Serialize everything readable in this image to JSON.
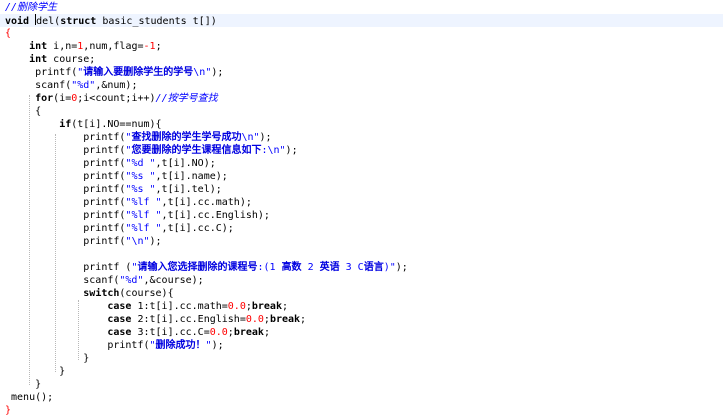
{
  "editor": {
    "lines": [
      [
        {
          "t": "cmt",
          "v": "//删除学生"
        }
      ],
      [
        {
          "t": "kw",
          "v": "void "
        },
        {
          "t": "plain",
          "v": "del"
        },
        {
          "t": "plain",
          "v": "("
        },
        {
          "t": "kw",
          "v": "struct"
        },
        {
          "t": "plain",
          "v": " basic_students t[])"
        }
      ],
      [
        {
          "t": "brace-red",
          "v": "{"
        }
      ],
      [
        {
          "t": "plain",
          "v": "    "
        },
        {
          "t": "kw",
          "v": "int"
        },
        {
          "t": "plain",
          "v": " i,n="
        },
        {
          "t": "num",
          "v": "1"
        },
        {
          "t": "plain",
          "v": ",num,flag="
        },
        {
          "t": "num",
          "v": "-1"
        },
        {
          "t": "plain",
          "v": ";"
        }
      ],
      [
        {
          "t": "plain",
          "v": "    "
        },
        {
          "t": "kw",
          "v": "int"
        },
        {
          "t": "plain",
          "v": " course;"
        }
      ],
      [
        {
          "t": "plain",
          "v": "     printf("
        },
        {
          "t": "str",
          "v": "\""
        },
        {
          "t": "cjk",
          "v": "请输入要删除学生的学号"
        },
        {
          "t": "str",
          "v": "\\n\""
        },
        {
          "t": "plain",
          "v": ");"
        }
      ],
      [
        {
          "t": "plain",
          "v": "     scanf("
        },
        {
          "t": "str",
          "v": "\"%d\""
        },
        {
          "t": "plain",
          "v": ",&num);"
        }
      ],
      [
        {
          "t": "plain",
          "v": "     "
        },
        {
          "t": "kw",
          "v": "for"
        },
        {
          "t": "plain",
          "v": "(i="
        },
        {
          "t": "num",
          "v": "0"
        },
        {
          "t": "plain",
          "v": ";i<count;i++)"
        },
        {
          "t": "cmt",
          "v": "//按学号查找"
        }
      ],
      [
        {
          "t": "plain",
          "v": "     {"
        }
      ],
      [
        {
          "t": "plain",
          "v": "         "
        },
        {
          "t": "kw",
          "v": "if"
        },
        {
          "t": "plain",
          "v": "(t[i].NO==num){"
        }
      ],
      [
        {
          "t": "plain",
          "v": "             printf("
        },
        {
          "t": "str",
          "v": "\""
        },
        {
          "t": "cjk",
          "v": "查找删除的学生学号成功"
        },
        {
          "t": "str",
          "v": "\\n\""
        },
        {
          "t": "plain",
          "v": ");"
        }
      ],
      [
        {
          "t": "plain",
          "v": "             printf("
        },
        {
          "t": "str",
          "v": "\""
        },
        {
          "t": "cjk",
          "v": "您要删除的学生课程信息如下"
        },
        {
          "t": "str",
          "v": ":\\n\""
        },
        {
          "t": "plain",
          "v": ");"
        }
      ],
      [
        {
          "t": "plain",
          "v": "             printf("
        },
        {
          "t": "str",
          "v": "\"%d \""
        },
        {
          "t": "plain",
          "v": ",t[i].NO);"
        }
      ],
      [
        {
          "t": "plain",
          "v": "             printf("
        },
        {
          "t": "str",
          "v": "\"%s \""
        },
        {
          "t": "plain",
          "v": ",t[i].name);"
        }
      ],
      [
        {
          "t": "plain",
          "v": "             printf("
        },
        {
          "t": "str",
          "v": "\"%s \""
        },
        {
          "t": "plain",
          "v": ",t[i].tel);"
        }
      ],
      [
        {
          "t": "plain",
          "v": "             printf("
        },
        {
          "t": "str",
          "v": "\"%lf \""
        },
        {
          "t": "plain",
          "v": ",t[i].cc.math);"
        }
      ],
      [
        {
          "t": "plain",
          "v": "             printf("
        },
        {
          "t": "str",
          "v": "\"%lf \""
        },
        {
          "t": "plain",
          "v": ",t[i].cc.English);"
        }
      ],
      [
        {
          "t": "plain",
          "v": "             printf("
        },
        {
          "t": "str",
          "v": "\"%lf \""
        },
        {
          "t": "plain",
          "v": ",t[i].cc.C);"
        }
      ],
      [
        {
          "t": "plain",
          "v": "             printf("
        },
        {
          "t": "str",
          "v": "\"\\n\""
        },
        {
          "t": "plain",
          "v": ");"
        }
      ],
      [
        {
          "t": "plain",
          "v": ""
        }
      ],
      [
        {
          "t": "plain",
          "v": "             printf ("
        },
        {
          "t": "str",
          "v": "\""
        },
        {
          "t": "cjk",
          "v": "请输入您选择删除的课程号"
        },
        {
          "t": "str",
          "v": ":(1 "
        },
        {
          "t": "cjk",
          "v": "高数"
        },
        {
          "t": "str",
          "v": " 2 "
        },
        {
          "t": "cjk",
          "v": "英语"
        },
        {
          "t": "str",
          "v": " 3 C"
        },
        {
          "t": "cjk",
          "v": "语言"
        },
        {
          "t": "str",
          "v": ")\""
        },
        {
          "t": "plain",
          "v": ");"
        }
      ],
      [
        {
          "t": "plain",
          "v": "             scanf("
        },
        {
          "t": "str",
          "v": "\"%d\""
        },
        {
          "t": "plain",
          "v": ",&course);"
        }
      ],
      [
        {
          "t": "plain",
          "v": "             "
        },
        {
          "t": "kw",
          "v": "switch"
        },
        {
          "t": "plain",
          "v": "(course){"
        }
      ],
      [
        {
          "t": "plain",
          "v": "                 "
        },
        {
          "t": "kw",
          "v": "case"
        },
        {
          "t": "plain",
          "v": " 1:t[i].cc.math="
        },
        {
          "t": "num",
          "v": "0.0"
        },
        {
          "t": "plain",
          "v": ";"
        },
        {
          "t": "kw",
          "v": "break"
        },
        {
          "t": "plain",
          "v": ";"
        }
      ],
      [
        {
          "t": "plain",
          "v": "                 "
        },
        {
          "t": "kw",
          "v": "case"
        },
        {
          "t": "plain",
          "v": " 2:t[i].cc.English="
        },
        {
          "t": "num",
          "v": "0.0"
        },
        {
          "t": "plain",
          "v": ";"
        },
        {
          "t": "kw",
          "v": "break"
        },
        {
          "t": "plain",
          "v": ";"
        }
      ],
      [
        {
          "t": "plain",
          "v": "                 "
        },
        {
          "t": "kw",
          "v": "case"
        },
        {
          "t": "plain",
          "v": " 3:t[i].cc.C="
        },
        {
          "t": "num",
          "v": "0.0"
        },
        {
          "t": "plain",
          "v": ";"
        },
        {
          "t": "kw",
          "v": "break"
        },
        {
          "t": "plain",
          "v": ";"
        }
      ],
      [
        {
          "t": "plain",
          "v": "                 printf("
        },
        {
          "t": "str",
          "v": "\""
        },
        {
          "t": "cjk",
          "v": "删除成功！"
        },
        {
          "t": "str",
          "v": "\""
        },
        {
          "t": "plain",
          "v": ");"
        }
      ],
      [
        {
          "t": "plain",
          "v": "             }"
        }
      ],
      [
        {
          "t": "plain",
          "v": "         }"
        }
      ],
      [
        {
          "t": "plain",
          "v": "     }"
        }
      ],
      [
        {
          "t": "plain",
          "v": " menu();"
        }
      ],
      [
        {
          "t": "brace-red",
          "v": "}"
        }
      ]
    ]
  }
}
